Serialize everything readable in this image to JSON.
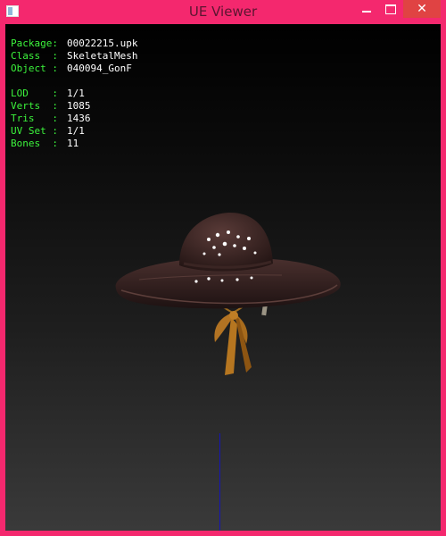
{
  "window": {
    "title": "UE Viewer"
  },
  "titlebar": {
    "minimize_icon": "minimize-icon",
    "maximize_icon": "maximize-icon",
    "close_icon": "close-icon"
  },
  "info": {
    "package": {
      "label": "Package:",
      "value": "00022215.upk"
    },
    "class": {
      "label": "Class  :",
      "value": "SkeletalMesh"
    },
    "object": {
      "label": "Object :",
      "value": "040094_GonF"
    },
    "lod": {
      "label": "LOD    :",
      "value": "1/1"
    },
    "verts": {
      "label": "Verts  :",
      "value": "1085"
    },
    "tris": {
      "label": "Tris   :",
      "value": "1436"
    },
    "uvset": {
      "label": "UV Set :",
      "value": "1/1"
    },
    "bones": {
      "label": "Bones  :",
      "value": "11"
    }
  },
  "colors": {
    "frame": "#f4286e",
    "info_label": "#3cf43c",
    "info_value": "#ffffff",
    "axis": "#1515b5",
    "close_button": "#e04343"
  }
}
